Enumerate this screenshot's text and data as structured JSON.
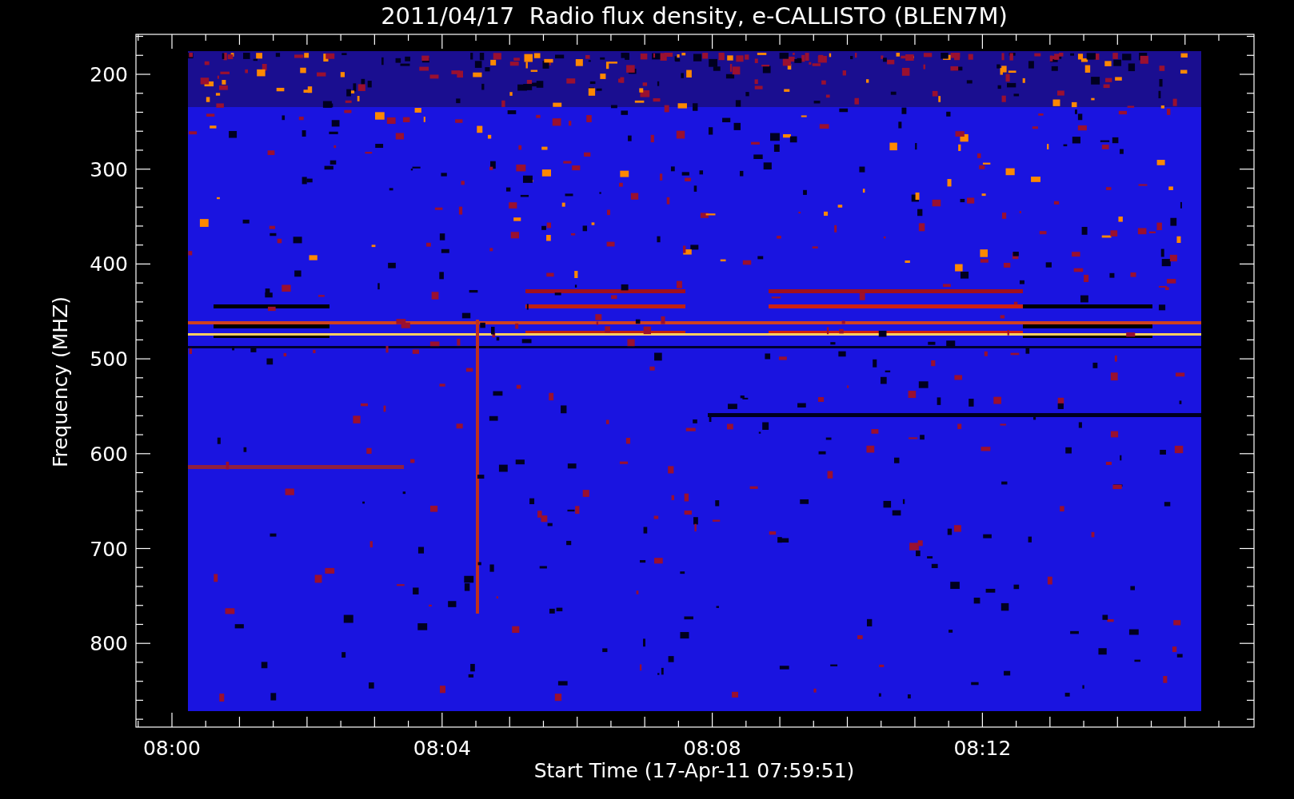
{
  "plot": {
    "title": "2011/04/17  Radio flux density, e-CALLISTO (BLEN7M)",
    "y_axis": {
      "label": "Frequency (MHZ)",
      "ticks": [
        "200",
        "300",
        "400",
        "500",
        "600",
        "700",
        "800"
      ]
    },
    "x_axis": {
      "label": "Start Time (17-Apr-11 07:59:51)",
      "ticks": [
        "08:00",
        "08:04",
        "08:08",
        "08:12"
      ]
    }
  }
}
